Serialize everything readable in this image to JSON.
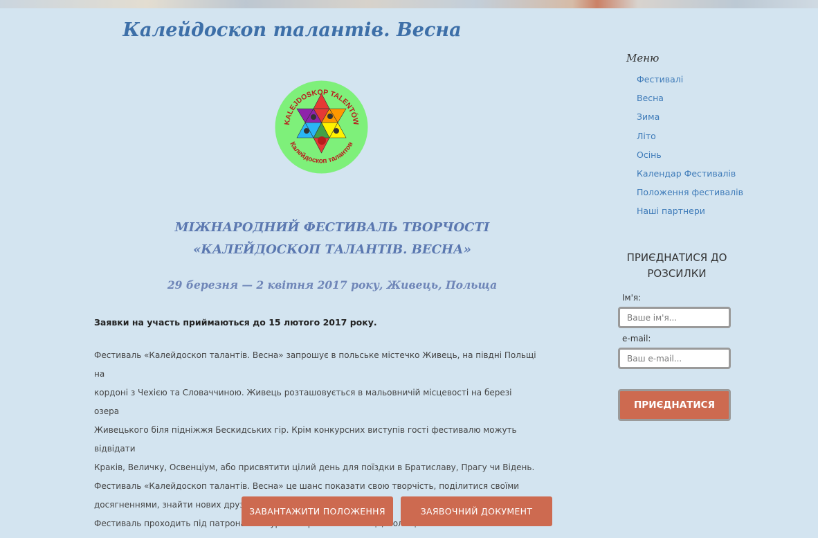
{
  "main": {
    "title": "Калейдоскоп талантів. Весна",
    "logo": {
      "top_text": "KALEJDOSKOP TALENTÓW",
      "bottom_text": "Калейдоскоп талантов"
    },
    "heading_line1": "МІЖНАРОДНИЙ ФЕСТИВАЛЬ ТВОРЧОСТІ",
    "heading_line2": "«КАЛЕЙДОСКОП ТАЛАНТІВ. ВЕСНА»",
    "dates": "29 березня — 2 квітня 2017 року, Живець, Польща",
    "deadline": "Заявки на участь приймаються до 15 лютого 2017 року.",
    "description": [
      "Фестиваль «Калейдоскоп талантів. Весна» запрошує в польське містечко Живець, на півдні Польщі на",
      "кордоні з Чехією та Словаччиною. Живець розташовується в мальовничій місцевості на березі озера",
      "Живецького біля підніжжя Бескидських гір. Крім конкурсних виступів гості фестивалю можуть відвідати",
      "Краків, Величку, Освенціум, або присвятити цілий день для поїздки в Братиславу, Прагу чи Відень.",
      "Фестиваль «Калейдоскоп талантів. Весна» це шанс показати свою творчість, поділитися своїми",
      "досягненнями, знайти нових друзів.",
      "Фестиваль проходить під патронатом Бургомістра міста Живець, Польща"
    ],
    "buttons": {
      "download": "ЗАВАНТАЖИТИ ПОЛОЖЕННЯ",
      "application": "ЗАЯВОЧНИЙ ДОКУМЕНТ"
    }
  },
  "sidebar": {
    "menu_title": "Меню",
    "menu_items": [
      {
        "label": "Фестивалі"
      },
      {
        "label": "Весна"
      },
      {
        "label": "Зима"
      },
      {
        "label": "Літо"
      },
      {
        "label": "Осінь"
      },
      {
        "label": "Календар Фестивалів"
      },
      {
        "label": "Положення фестивалів"
      },
      {
        "label": "Наші партнери"
      }
    ],
    "subscribe": {
      "title_line1": "ПРИЄДНАТИСЯ ДО",
      "title_line2": "РОЗСИЛКИ",
      "name_label": "Ім'я:",
      "name_placeholder": "Ваше ім'я...",
      "email_label": "e-mail:",
      "email_placeholder": "Ваш e-mail...",
      "button": "ПРИЄДНАТИСЯ"
    }
  },
  "colors": {
    "background": "#d3e4f0",
    "accent": "#cd6a50",
    "title_blue": "#3d6fa8",
    "link_blue": "#3d7ab8"
  }
}
